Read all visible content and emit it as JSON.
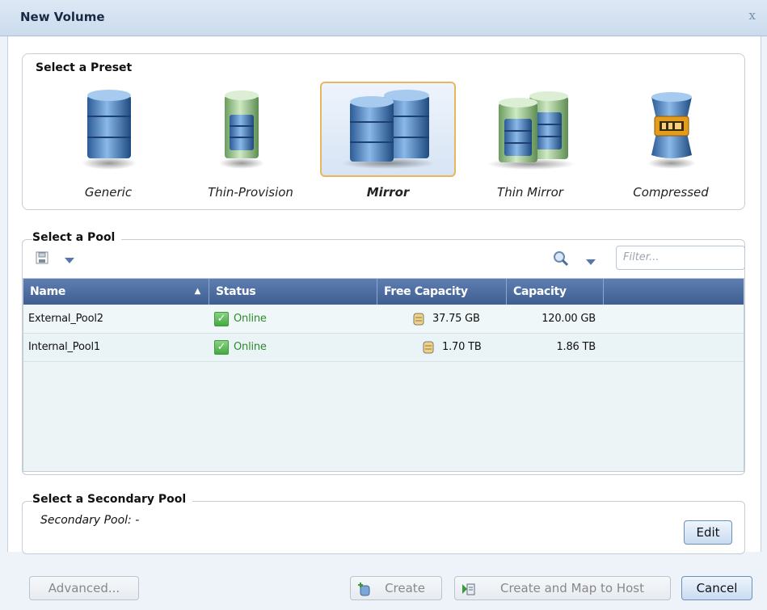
{
  "dialog": {
    "title": "New Volume",
    "close_glyph": "x"
  },
  "preset_group": {
    "legend": "Select a Preset",
    "presets": [
      {
        "label": "Generic",
        "icon": "generic-volume-icon"
      },
      {
        "label": "Thin-Provision",
        "icon": "thin-provision-volume-icon"
      },
      {
        "label": "Mirror",
        "icon": "mirror-volume-icon",
        "selected": true
      },
      {
        "label": "Thin Mirror",
        "icon": "thin-mirror-volume-icon"
      },
      {
        "label": "Compressed",
        "icon": "compressed-volume-icon"
      }
    ]
  },
  "pool_group": {
    "legend": "Select a Pool",
    "filter_placeholder": "Filter...",
    "columns": [
      "Name",
      "Status",
      "Free Capacity",
      "Capacity"
    ],
    "rows": [
      {
        "name": "External_Pool2",
        "status": "Online",
        "free": "37.75 GB",
        "capacity": "120.00 GB"
      },
      {
        "name": "Internal_Pool1",
        "status": "Online",
        "free": "1.70 TB",
        "capacity": "1.86 TB"
      }
    ]
  },
  "secondary_group": {
    "legend": "Select a Secondary Pool",
    "secondary_text": "Secondary Pool: -",
    "edit_label": "Edit"
  },
  "footer": {
    "advanced_label": "Advanced...",
    "create_label": "Create",
    "create_map_label": "Create and Map to Host",
    "cancel_label": "Cancel"
  },
  "colors": {
    "selected_border": "#e8b65e",
    "header_blue": "#4a6ba3",
    "online_green": "#2c8a2a"
  }
}
